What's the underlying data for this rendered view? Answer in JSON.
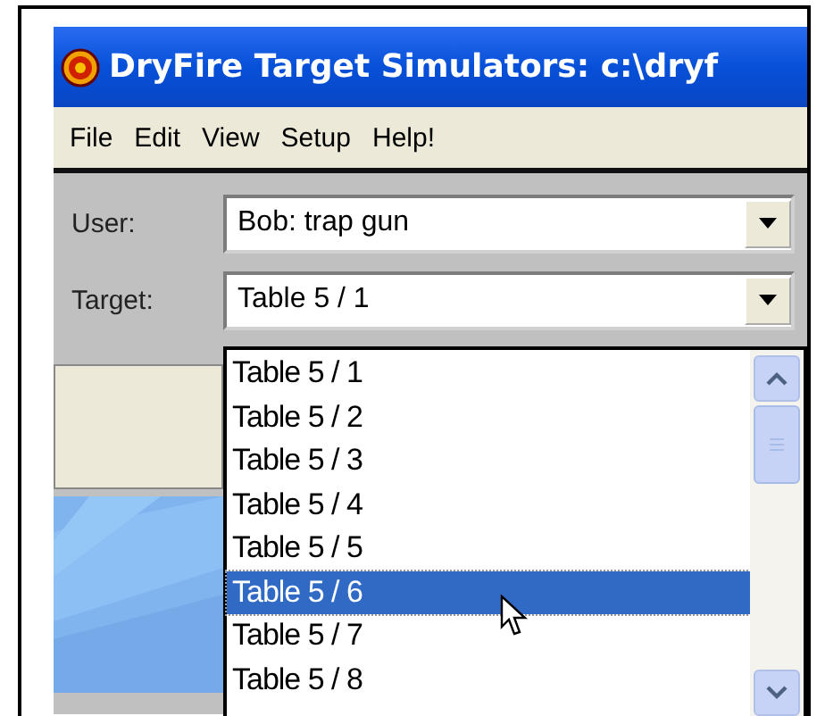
{
  "window": {
    "title": "DryFire Target Simulators: c:\\dryf"
  },
  "menu": [
    "File",
    "Edit",
    "View",
    "Setup",
    "Help!"
  ],
  "fields": [
    {
      "label": "User:",
      "value": "Bob: trap gun"
    },
    {
      "label": "Target:",
      "value": "Table 5 / 1"
    }
  ],
  "dropdown": {
    "items": [
      {
        "label": "Table 5 / 1",
        "selected": false
      },
      {
        "label": "Table 5 / 2",
        "selected": false
      },
      {
        "label": "Table 5 / 3",
        "selected": false
      },
      {
        "label": "Table 5 / 4",
        "selected": false
      },
      {
        "label": "Table 5 / 5",
        "selected": false
      },
      {
        "label": "Table 5 / 6",
        "selected": true
      },
      {
        "label": "Table 5 / 7",
        "selected": false
      },
      {
        "label": "Table 5 / 8",
        "selected": false
      }
    ]
  }
}
